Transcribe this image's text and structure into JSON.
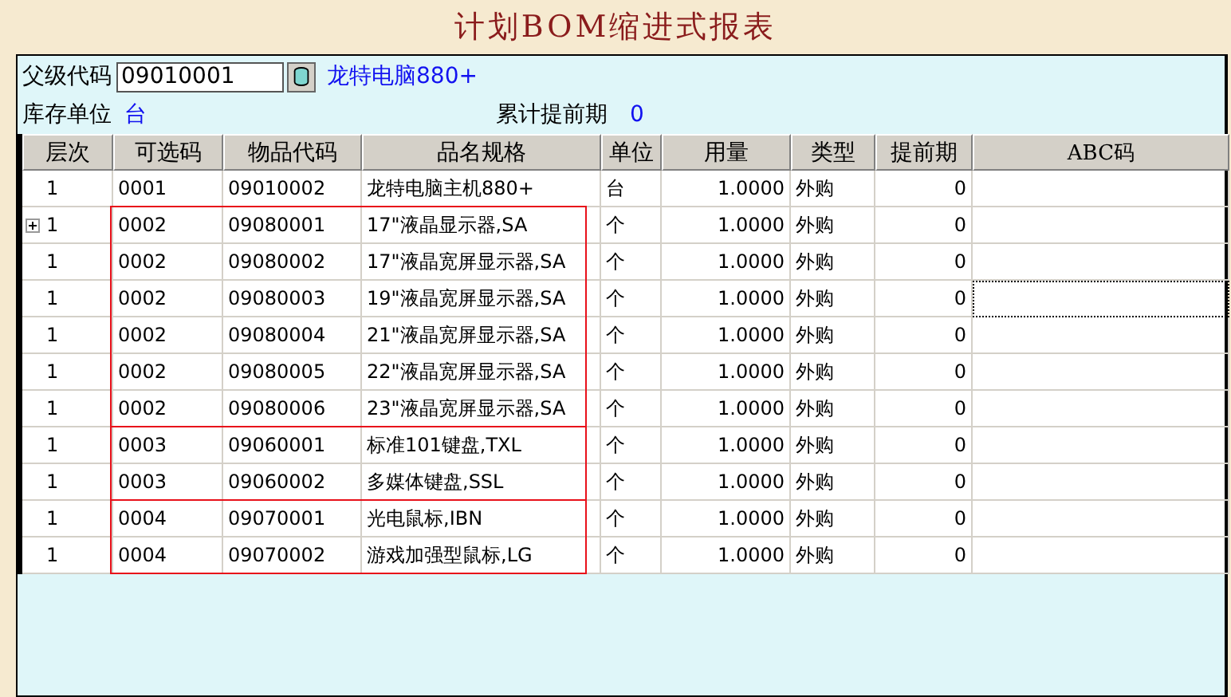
{
  "window": {
    "title": "计划BOM缩进式报表"
  },
  "header": {
    "parent_code_label": "父级代码",
    "parent_code": "09010001",
    "parent_name": "龙特电脑880+",
    "unit_label": "库存单位",
    "unit": "台",
    "lead_label": "累计提前期",
    "lead": "0"
  },
  "table": {
    "columns": [
      "层次",
      "可选码",
      "物品代码",
      "品名规格",
      "单位",
      "用量",
      "类型",
      "提前期",
      "ABC码"
    ],
    "row_groups": [
      {
        "boxed": false,
        "rows": [
          {
            "cells": [
              "1",
              "0001",
              "09010002",
              "龙特电脑主机880+",
              "台",
              "1.0000",
              "外购",
              "0",
              ""
            ],
            "expandable": false,
            "focused": false
          }
        ]
      },
      {
        "boxed": true,
        "rows": [
          {
            "cells": [
              "1",
              "0002",
              "09080001",
              "17\"液晶显示器,SA",
              "个",
              "1.0000",
              "外购",
              "0",
              ""
            ],
            "expandable": true,
            "focused": false
          },
          {
            "cells": [
              "1",
              "0002",
              "09080002",
              "17\"液晶宽屏显示器,SA",
              "个",
              "1.0000",
              "外购",
              "0",
              ""
            ],
            "expandable": false,
            "focused": false
          },
          {
            "cells": [
              "1",
              "0002",
              "09080003",
              "19\"液晶宽屏显示器,SA",
              "个",
              "1.0000",
              "外购",
              "0",
              ""
            ],
            "expandable": false,
            "focused": true
          },
          {
            "cells": [
              "1",
              "0002",
              "09080004",
              "21\"液晶宽屏显示器,SA",
              "个",
              "1.0000",
              "外购",
              "0",
              ""
            ],
            "expandable": false,
            "focused": false
          },
          {
            "cells": [
              "1",
              "0002",
              "09080005",
              "22\"液晶宽屏显示器,SA",
              "个",
              "1.0000",
              "外购",
              "0",
              ""
            ],
            "expandable": false,
            "focused": false
          },
          {
            "cells": [
              "1",
              "0002",
              "09080006",
              "23\"液晶宽屏显示器,SA",
              "个",
              "1.0000",
              "外购",
              "0",
              ""
            ],
            "expandable": false,
            "focused": false
          }
        ]
      },
      {
        "boxed": true,
        "rows": [
          {
            "cells": [
              "1",
              "0003",
              "09060001",
              "标准101键盘,TXL",
              "个",
              "1.0000",
              "外购",
              "0",
              ""
            ],
            "expandable": false,
            "focused": false
          },
          {
            "cells": [
              "1",
              "0003",
              "09060002",
              "多媒体键盘,SSL",
              "个",
              "1.0000",
              "外购",
              "0",
              ""
            ],
            "expandable": false,
            "focused": false
          }
        ]
      },
      {
        "boxed": true,
        "rows": [
          {
            "cells": [
              "1",
              "0004",
              "09070001",
              "光电鼠标,IBN",
              "个",
              "1.0000",
              "外购",
              "0",
              ""
            ],
            "expandable": false,
            "focused": false
          },
          {
            "cells": [
              "1",
              "0004",
              "09070002",
              "游戏加强型鼠标,LG",
              "个",
              "1.0000",
              "外购",
              "0",
              ""
            ],
            "expandable": false,
            "focused": false
          }
        ]
      }
    ]
  }
}
